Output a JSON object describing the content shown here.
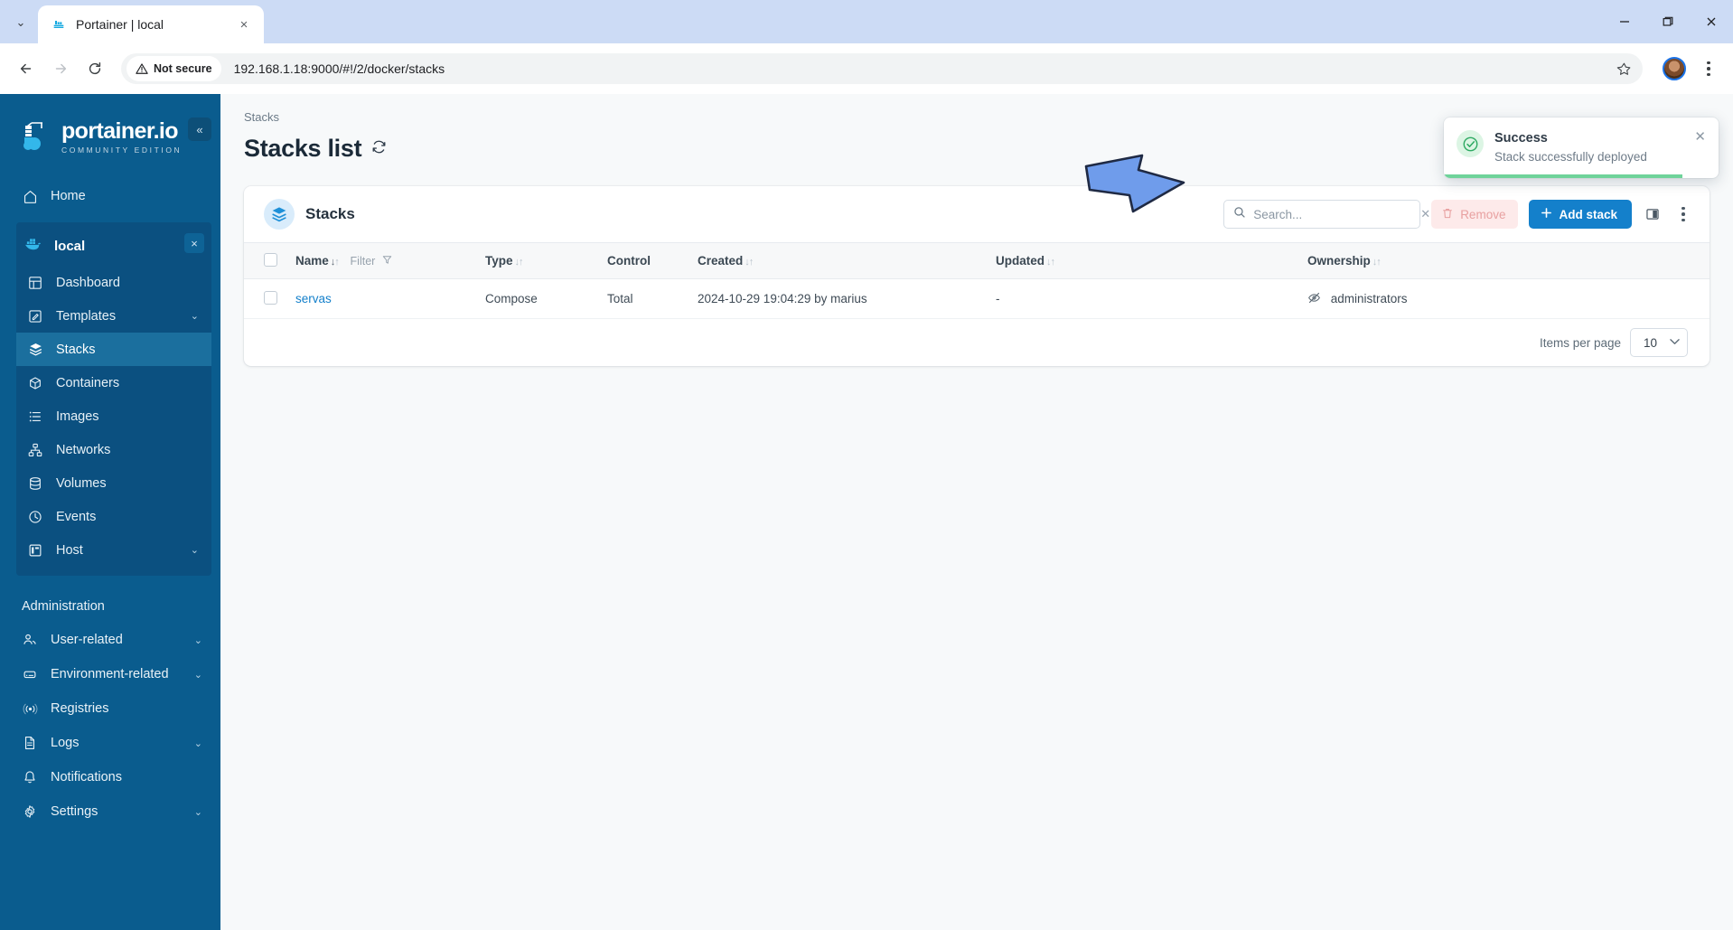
{
  "browser": {
    "tab": {
      "title": "Portainer | local",
      "favicon": "portainer-icon",
      "close": "×"
    },
    "tab_list_chevron": "⌄",
    "window": {
      "minimize": "—",
      "maximize": "❐",
      "close": "✕"
    },
    "nav": {
      "back": "←",
      "forward": "→",
      "reload": "↻"
    },
    "security_label": "Not secure",
    "url": "192.168.1.18:9000/#!/2/docker/stacks",
    "bookmark_icon": "star-icon",
    "menu_icon": "kebab-icon"
  },
  "sidebar": {
    "logo_name": "portainer.io",
    "logo_sub": "COMMUNITY EDITION",
    "collapse": "«",
    "home": {
      "label": "Home",
      "icon": "home-icon"
    },
    "environment": {
      "name": "local",
      "icon": "docker-icon",
      "close": "×",
      "items": [
        {
          "label": "Dashboard",
          "icon": "dashboard-icon",
          "active": false,
          "chevron": ""
        },
        {
          "label": "Templates",
          "icon": "templates-icon",
          "active": false,
          "chevron": "⌄"
        },
        {
          "label": "Stacks",
          "icon": "stacks-icon",
          "active": true,
          "chevron": ""
        },
        {
          "label": "Containers",
          "icon": "containers-icon",
          "active": false,
          "chevron": ""
        },
        {
          "label": "Images",
          "icon": "images-icon",
          "active": false,
          "chevron": ""
        },
        {
          "label": "Networks",
          "icon": "networks-icon",
          "active": false,
          "chevron": ""
        },
        {
          "label": "Volumes",
          "icon": "volumes-icon",
          "active": false,
          "chevron": ""
        },
        {
          "label": "Events",
          "icon": "events-icon",
          "active": false,
          "chevron": ""
        },
        {
          "label": "Host",
          "icon": "host-icon",
          "active": false,
          "chevron": "⌄"
        }
      ]
    },
    "admin_title": "Administration",
    "admin_items": [
      {
        "label": "User-related",
        "icon": "users-icon",
        "chevron": "⌄"
      },
      {
        "label": "Environment-related",
        "icon": "environment-icon",
        "chevron": "⌄"
      },
      {
        "label": "Registries",
        "icon": "registries-icon",
        "chevron": ""
      },
      {
        "label": "Logs",
        "icon": "logs-icon",
        "chevron": "⌄"
      },
      {
        "label": "Notifications",
        "icon": "bell-icon",
        "chevron": ""
      },
      {
        "label": "Settings",
        "icon": "gear-icon",
        "chevron": "⌄"
      }
    ]
  },
  "main": {
    "breadcrumb": "Stacks",
    "page_title": "Stacks list",
    "refresh_icon": "refresh-icon",
    "card": {
      "title": "Stacks",
      "title_icon": "stacks-icon",
      "search": {
        "placeholder": "Search...",
        "value": "",
        "icon": "search-icon",
        "clear": "✕"
      },
      "remove_label": "Remove",
      "remove_icon": "trash-icon",
      "add_label": "Add stack",
      "add_icon": "plus-icon",
      "columns_icon": "columns-icon",
      "more_icon": "kebab-icon",
      "columns": [
        {
          "label": "Name",
          "sortable": true,
          "sorted": "asc",
          "filter": "Filter"
        },
        {
          "label": "Type",
          "sortable": true,
          "sorted": "none",
          "filter": ""
        },
        {
          "label": "Control",
          "sortable": false,
          "sorted": "none",
          "filter": ""
        },
        {
          "label": "Created",
          "sortable": true,
          "sorted": "none",
          "filter": ""
        },
        {
          "label": "Updated",
          "sortable": true,
          "sorted": "none",
          "filter": ""
        },
        {
          "label": "Ownership",
          "sortable": true,
          "sorted": "none",
          "filter": ""
        }
      ],
      "rows": [
        {
          "name": "servas",
          "type": "Compose",
          "control": "Total",
          "created": "2024-10-29 19:04:29 by marius",
          "updated": "-",
          "ownership": "administrators",
          "ownership_icon": "eye-off-icon"
        }
      ],
      "items_per_page_label": "Items per page",
      "items_per_page_value": "10",
      "items_per_page_chevron": "⌄"
    }
  },
  "toast": {
    "title": "Success",
    "message": "Stack successfully deployed",
    "icon": "check-circle-icon",
    "close": "✕",
    "accent": "#6fd39a"
  },
  "annotation": {
    "arrow": "right-arrow-annotation",
    "color": "#6f9ceb"
  }
}
